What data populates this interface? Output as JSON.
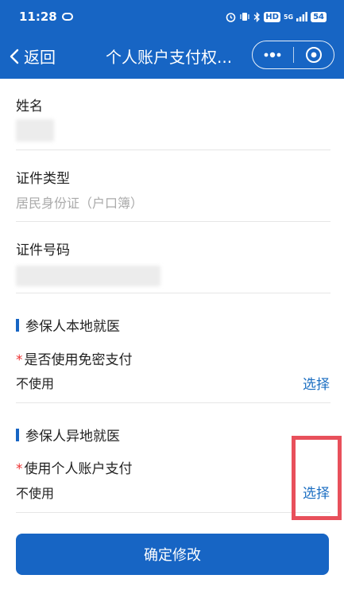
{
  "status_bar": {
    "time": "11:28",
    "network": "5G",
    "battery": "54",
    "hd": "HD"
  },
  "nav": {
    "back_label": "返回",
    "title": "个人账户支付权..."
  },
  "form": {
    "name_label": "姓名",
    "id_type_label": "证件类型",
    "id_type_value": "居民身份证（户口簿）",
    "id_number_label": "证件号码"
  },
  "local_section": {
    "title": "参保人本地就医",
    "required_mark": "*",
    "question": "是否使用免密支付",
    "value": "不使用",
    "select_label": "选择"
  },
  "remote_section": {
    "title": "参保人异地就医",
    "required_mark": "*",
    "question": "使用个人账户支付",
    "value": "不使用",
    "select_label": "选择"
  },
  "confirm_button": "确定修改",
  "colors": {
    "primary": "#1765c4",
    "link": "#1b6ec2",
    "required": "#e33333",
    "highlight": "#e8505b"
  }
}
